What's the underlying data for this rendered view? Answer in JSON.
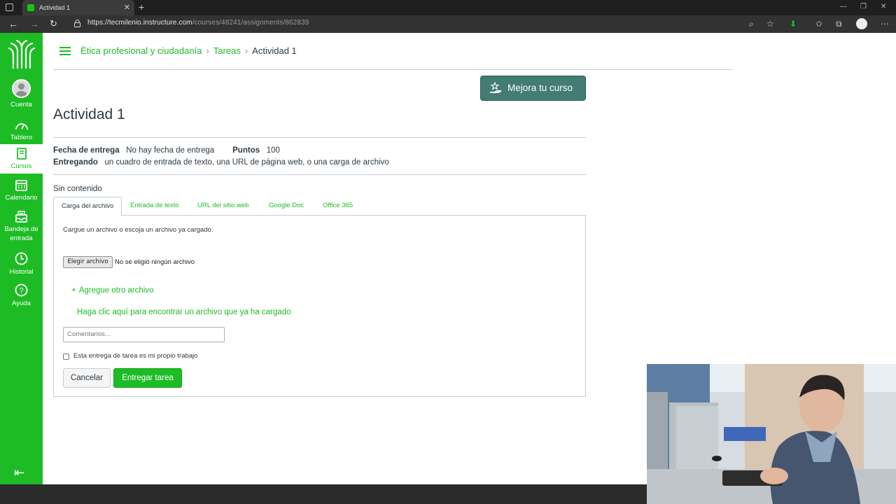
{
  "browser": {
    "tab_title": "Actividad 1",
    "url_host": "https://tecmilenio.instructure.com",
    "url_path": "/courses/48241/assignments/862839"
  },
  "sidebar": {
    "items": [
      {
        "label": "Cuenta",
        "icon": "account-avatar"
      },
      {
        "label": "Tablero",
        "icon": "dashboard-gauge-icon"
      },
      {
        "label": "Cursos",
        "icon": "book-icon",
        "active": true
      },
      {
        "label": "Calendario",
        "icon": "calendar-icon"
      },
      {
        "label": "Bandeja de entrada",
        "icon": "inbox-icon"
      },
      {
        "label": "Historial",
        "icon": "clock-icon"
      },
      {
        "label": "Ayuda",
        "icon": "help-icon"
      }
    ]
  },
  "breadcrumb": {
    "course": "Ética profesional y ciudadanía",
    "section": "Tareas",
    "current": "Actividad 1"
  },
  "mejora_button": "Mejora tu curso",
  "assignment": {
    "title": "Actividad 1",
    "due_label": "Fecha de entrega",
    "due_value": "No hay fecha de entrega",
    "points_label": "Puntos",
    "points_value": "100",
    "submitting_label": "Entregando",
    "submitting_value": "un cuadro de entrada de texto, una URL de página web, o una carga de archivo",
    "status": "Sin contenido"
  },
  "tabs": [
    "Carga del archivo",
    "Entrada de texto",
    "URL del sitio web",
    "Google Doc",
    "Office 365"
  ],
  "upload": {
    "instructions": "Cargue un archivo o escoja un archivo ya cargado.",
    "choose_button": "Elegir archivo",
    "no_file": "No se eligió ningún archivo",
    "add_another": "Agregue otro archivo",
    "find_uploaded": "Haga clic aquí para encontrar un archivo que ya ha cargado",
    "comments_placeholder": "Comentarios...",
    "own_work": "Esta entrega de tarea es mi propio trabajo",
    "cancel": "Cancelar",
    "submit": "Entregar tarea"
  },
  "colors": {
    "brand": "#1dbc24",
    "mejora": "#437c72",
    "text": "#2d3b45"
  }
}
